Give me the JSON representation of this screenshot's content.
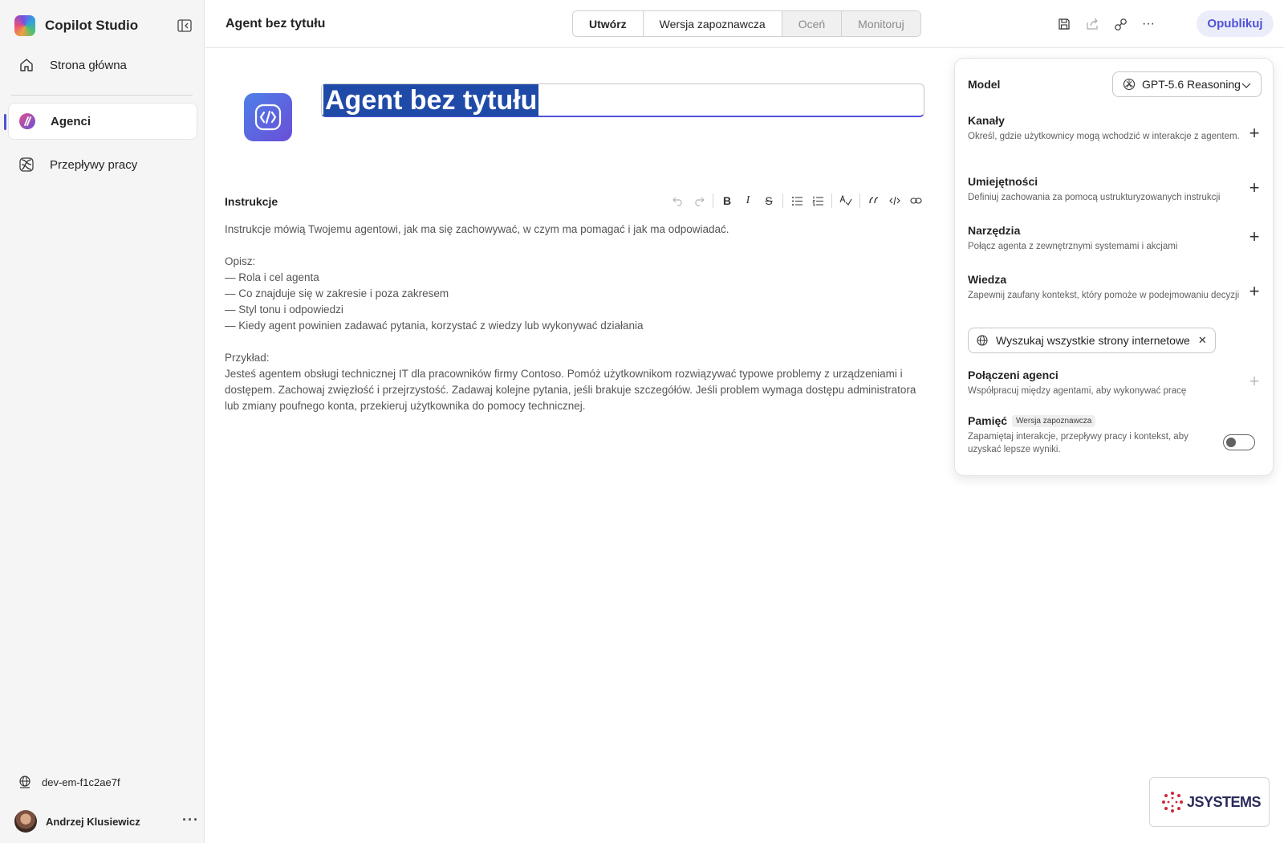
{
  "app": {
    "name": "Copilot Studio"
  },
  "sidebar": {
    "items": [
      {
        "label": "Strona główna",
        "icon": "home-icon"
      },
      {
        "label": "Agenci",
        "icon": "agents-icon",
        "active": true
      },
      {
        "label": "Przepływy pracy",
        "icon": "workflows-icon"
      }
    ],
    "environment": "dev-em-f1c2ae7f",
    "user": "Andrzej Klusiewicz",
    "more": "···"
  },
  "header": {
    "title": "Agent bez tytułu",
    "tabs": [
      {
        "label": "Utwórz",
        "state": "active"
      },
      {
        "label": "Wersja zapoznawcza",
        "state": "enabled"
      },
      {
        "label": "Oceń",
        "state": "disabled"
      },
      {
        "label": "Monitoruj",
        "state": "disabled"
      }
    ],
    "publish": "Opublikuj",
    "more": "···"
  },
  "main": {
    "name_value": "Agent bez tytułu",
    "instructions_label": "Instrukcje",
    "instructions": [
      "Instrukcje mówią Twojemu agentowi, jak ma się zachowywać, w czym ma pomagać i jak ma odpowiadać.",
      "",
      "Opisz:",
      "— Rola i cel agenta",
      "— Co znajduje się w zakresie i poza zakresem",
      "— Styl tonu i odpowiedzi",
      "— Kiedy agent powinien zadawać pytania, korzystać z wiedzy lub wykonywać działania",
      "",
      "Przykład:",
      "Jesteś agentem obsługi technicznej IT dla pracowników firmy Contoso. Pomóż użytkownikom rozwiązywać typowe problemy z urządzeniami i dostępem. Zachowaj zwięzłość i przejrzystość. Zadawaj kolejne pytania, jeśli brakuje szczegółów. Jeśli problem wymaga dostępu administratora lub zmiany poufnego konta, przekieruj użytkownika do pomocy technicznej."
    ]
  },
  "panel": {
    "model_label": "Model",
    "model_value": "GPT-5.6 Reasoning",
    "channels": {
      "title": "Kanały",
      "desc": "Określ, gdzie użytkownicy mogą wchodzić w interakcje z agentem."
    },
    "skills": {
      "title": "Umiejętności",
      "desc": "Definiuj zachowania za pomocą ustrukturyzowanych instrukcji"
    },
    "tools": {
      "title": "Narzędzia",
      "desc": "Połącz agenta z zewnętrznymi systemami i akcjami"
    },
    "knowledge": {
      "title": "Wiedza",
      "desc": "Zapewnij zaufany kontekst, który pomoże w podejmowaniu decyzji",
      "chip": "Wyszukaj wszystkie strony internetowe"
    },
    "connected": {
      "title": "Połączeni agenci",
      "desc": "Współpracuj między agentami, aby wykonywać pracę"
    },
    "memory": {
      "title": "Pamięć",
      "badge": "Wersja zapoznawcza",
      "desc": "Zapamiętaj interakcje, przepływy pracy i kontekst, aby uzyskać lepsze wyniki.",
      "enabled": false
    }
  },
  "watermark": {
    "text": "JSYSTEMS"
  },
  "colors": {
    "accent": "#4f52d6",
    "selection": "#1f4aa8",
    "publish_bg": "#ebedfb"
  }
}
